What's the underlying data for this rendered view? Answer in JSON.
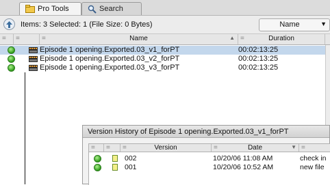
{
  "tabs": [
    {
      "label": "Pro Tools",
      "icon": "folder-icon",
      "active": true
    },
    {
      "label": "Search",
      "icon": "magnifier-icon",
      "active": false
    }
  ],
  "status": {
    "text": "Items: 3 Selected: 1 (File Size: 0 Bytes)",
    "sort_value": "Name",
    "up_icon": "up-arrow-icon"
  },
  "main_table": {
    "columns": [
      {
        "label": "",
        "marker": "="
      },
      {
        "label": "",
        "marker": "="
      },
      {
        "label": "Name",
        "marker": "="
      },
      {
        "label": "Duration",
        "marker": "="
      }
    ],
    "rows": [
      {
        "name": "Episode 1 opening.Exported.03_v1_forPT",
        "duration": "00:02:13:25",
        "selected": true
      },
      {
        "name": "Episode 1 opening.Exported.03_v2_forPT",
        "duration": "00:02:13:25",
        "selected": false
      },
      {
        "name": "Episode 1 opening.Exported.03_v3_forPT",
        "duration": "00:02:13:25",
        "selected": false
      }
    ]
  },
  "version_history": {
    "title": "Version History of Episode 1 opening.Exported.03_v1_forPT",
    "columns": [
      {
        "label": "",
        "marker": "="
      },
      {
        "label": "",
        "marker": "="
      },
      {
        "label": "Version",
        "marker": "="
      },
      {
        "label": "Date",
        "marker": "="
      },
      {
        "label": "",
        "marker": "="
      }
    ],
    "rows": [
      {
        "version": "002",
        "date": "10/20/06 11:08 AM",
        "comment": "check in"
      },
      {
        "version": "001",
        "date": "10/20/06 10:52 AM",
        "comment": "new file"
      }
    ]
  },
  "colors": {
    "selection": "#c3d7ec",
    "status_dot": "#3aa81f"
  }
}
